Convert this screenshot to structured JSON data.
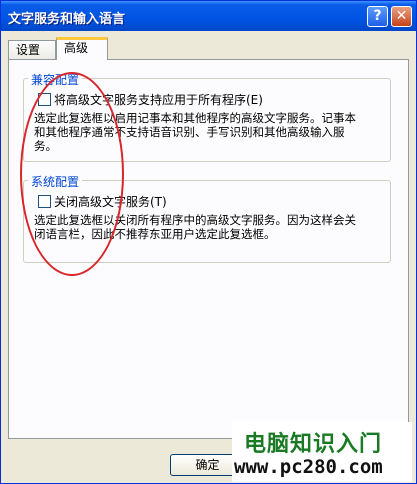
{
  "window": {
    "title": "文字服务和输入语言",
    "help_glyph": "?",
    "close_glyph": "✕"
  },
  "tabs": [
    {
      "label": "设置",
      "selected": false
    },
    {
      "label": "高级",
      "selected": true
    }
  ],
  "compat_group": {
    "title": "兼容配置",
    "checkbox_label": "将高级文字服务支持应用于所有程序(E)",
    "checked": false,
    "desc_lines": [
      "选定此复选框以启用记事本和其他程序的高级文字服务。记事本",
      "和其他程序通常不支持语音识别、手写识别和其他高级输入服",
      "务。"
    ]
  },
  "system_group": {
    "title": "系统配置",
    "checkbox_label": "关闭高级文字服务(T)",
    "checked": false,
    "desc_lines": [
      "选定此复选框以关闭所有程序中的高级文字服务。因为这样会关",
      "闭语言栏，因此不推荐东亚用户选定此复选框。"
    ]
  },
  "buttons": {
    "ok": "确定"
  },
  "watermark": {
    "text_cn": "电脑知识入门",
    "url": "www.pc280.com"
  },
  "colors": {
    "title_bar": "#0054e3",
    "group_title": "#0046d5",
    "annotation": "#d8262a"
  }
}
